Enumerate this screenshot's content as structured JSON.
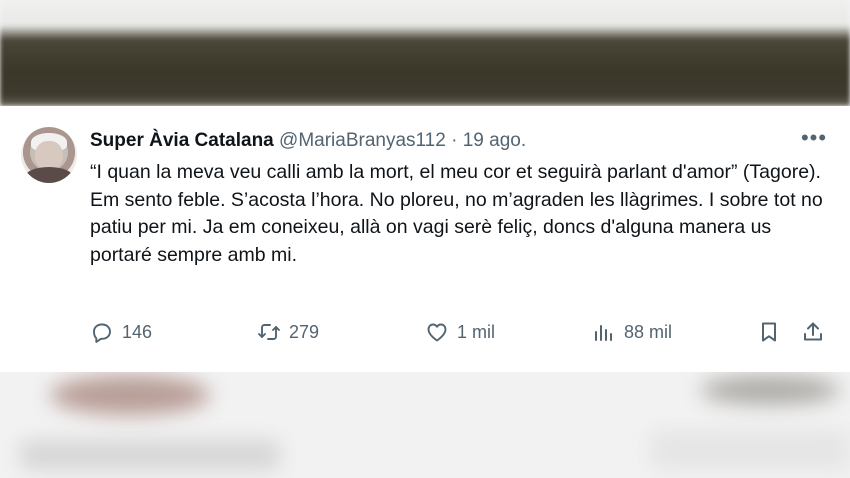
{
  "tweet": {
    "author_name": "Super Àvia Catalana",
    "handle": "@MariaBranyas112",
    "separator": "·",
    "date": "19 ago.",
    "more_label": "•••",
    "lines": [
      "“I quan la meva veu calli amb la mort, el meu cor et seguirà parlant d'amor” (Tagore).",
      "Em sento feble. S’acosta l’hora. No ploreu, no m’agraden les llàgrimes. I sobre tot no patiu per mi. Ja em coneixeu, allà on vagi serè feliç, doncs d'alguna manera us portaré sempre amb mi."
    ]
  },
  "actions": {
    "replies": "146",
    "retweets": "279",
    "likes": "1 mil",
    "views": "88 mil"
  },
  "icons": {
    "reply": "reply-icon",
    "retweet": "retweet-icon",
    "like": "heart-icon",
    "views": "views-icon",
    "bookmark": "bookmark-icon",
    "share": "share-icon"
  },
  "colors": {
    "text": "#0f1419",
    "secondary": "#536471",
    "card_bg": "#ffffff"
  }
}
